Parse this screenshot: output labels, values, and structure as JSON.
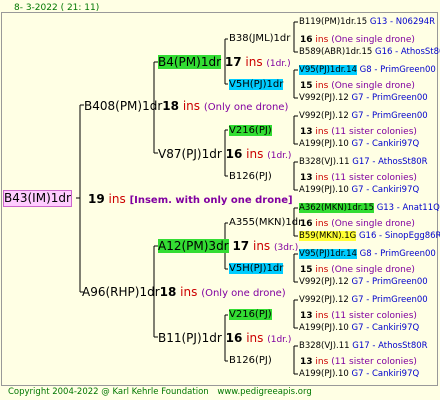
{
  "header": {
    "date": "8-  3-2022 ( 21: 11)"
  },
  "footer": {
    "copyright": "Copyright 2004-2022 @ Karl Kehrle Foundation",
    "site": "www.pedigreeapis.org"
  },
  "root": {
    "name": "B43(IM)1dr",
    "num": "19",
    "ins": "ins",
    "note": "[Insem. with only one drone]"
  },
  "g1": [
    {
      "name": "B408(PM)1dr",
      "num": "18",
      "ins": "ins",
      "note": "(Only one drone)"
    },
    {
      "name": "A96(RHP)1dr",
      "num": "18",
      "ins": "ins",
      "note": "(Only one drone)"
    }
  ],
  "g2": [
    {
      "name": "B4(PM)1dr",
      "num": "17",
      "ins": "ins",
      "note": "(1dr.)"
    },
    {
      "name": "V87(PJ)1dr",
      "num": "16",
      "ins": "ins",
      "note": "(1dr.)"
    },
    {
      "name": "A12(PM)3dr",
      "num": "17",
      "ins": "ins",
      "note": "(3dr.)"
    },
    {
      "name": "B11(PJ)1dr",
      "num": "16",
      "ins": "ins",
      "note": "(1dr.)"
    }
  ],
  "g3": [
    {
      "name": "B38(JML)1dr",
      "num": "16",
      "ins": "ins",
      "note": "(One single drone)"
    },
    {
      "name": "V5H(PJ)1dr",
      "num": "15",
      "ins": "ins",
      "note": "(One single drone)"
    },
    {
      "name": "V216(PJ)",
      "num": "13",
      "ins": "ins",
      "note": "(11 sister colonies)"
    },
    {
      "name": "B126(PJ)",
      "num": "13",
      "ins": "ins",
      "note": "(11 sister colonies)"
    },
    {
      "name": "A355(MKN)1dr",
      "num": "16",
      "ins": "ins",
      "note": "(One single drone)"
    },
    {
      "name": "V5H(PJ)1dr",
      "num": "15",
      "ins": "ins",
      "note": "(One single drone)"
    },
    {
      "name": "V216(PJ)",
      "num": "13",
      "ins": "ins",
      "note": "(11 sister colonies)"
    },
    {
      "name": "B126(PJ)",
      "num": "13",
      "ins": "ins",
      "note": "(11 sister colonies)"
    }
  ],
  "g4": [
    {
      "name": "B119(PM)1dr.15",
      "info": "G13 - N06294R"
    },
    {
      "name": "B589(ABR)1dr.15",
      "info": "G16 - AthosSt80R"
    },
    {
      "name": "V95(PJ)1dr.14",
      "info": "G8 - PrimGreen00"
    },
    {
      "name": "V992(PJ).12",
      "info": "G7 - PrimGreen00"
    },
    {
      "name": "V992(PJ).12",
      "info": "G7 - PrimGreen00"
    },
    {
      "name": "A199(PJ).10",
      "info": "G7 - Cankiri97Q"
    },
    {
      "name": "B328(VJ).11",
      "info": "G17 - AthosSt80R"
    },
    {
      "name": "A199(PJ).10",
      "info": "G7 - Cankiri97Q"
    },
    {
      "name": "A362(MKN)1dr.15",
      "info": "G13 - Anat11Q"
    },
    {
      "name": "B59(MKN).1G",
      "info": "G16 - SinopEgg86R"
    },
    {
      "name": "V95(PJ)1dr.14",
      "info": "G8 - PrimGreen00"
    },
    {
      "name": "V992(PJ).12",
      "info": "G7 - PrimGreen00"
    },
    {
      "name": "V992(PJ).12",
      "info": "G7 - PrimGreen00"
    },
    {
      "name": "A199(PJ).10",
      "info": "G7 - Cankiri97Q"
    },
    {
      "name": "B328(VJ).11",
      "info": "G17 - AthosSt80R"
    },
    {
      "name": "A199(PJ).10",
      "info": "G7 - Cankiri97Q"
    }
  ]
}
